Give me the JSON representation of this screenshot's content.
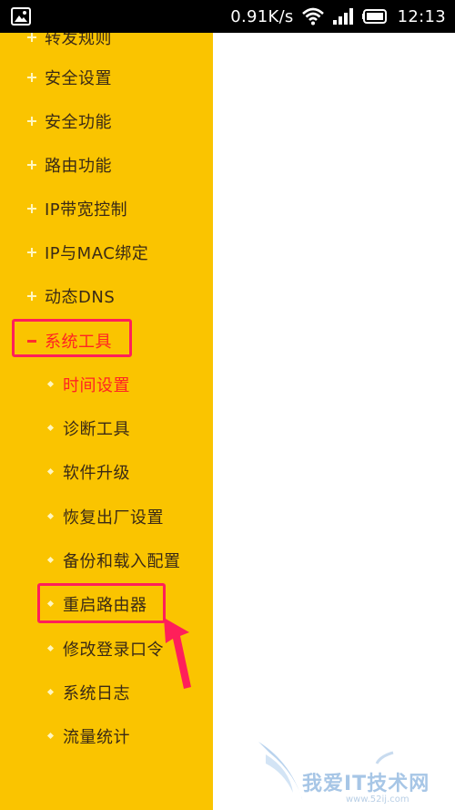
{
  "status_bar": {
    "net_speed": "0.91K/s",
    "time": "12:13",
    "icons": [
      "image-icon",
      "wifi-icon",
      "signal-icon",
      "battery-icon"
    ]
  },
  "colors": {
    "sidebar_bg": "#fac400",
    "menu_text": "#3a2a16",
    "active_text": "#ff2323",
    "highlight_border": "#ff1f5a",
    "arrow": "#ff1f5a"
  },
  "menu": {
    "top_items": [
      "转发规则",
      "安全设置",
      "安全功能",
      "路由功能",
      "IP带宽控制",
      "IP与MAC绑定",
      "动态DNS"
    ],
    "expanded_item": "系统工具",
    "sub_items": [
      "时间设置",
      "诊断工具",
      "软件升级",
      "恢复出厂设置",
      "备份和载入配置",
      "重启路由器",
      "修改登录口令",
      "系统日志",
      "流量统计"
    ],
    "active_sub_item": "时间设置"
  },
  "watermark": {
    "text": "我爱IT技术网",
    "url": "www.52ij.com"
  }
}
